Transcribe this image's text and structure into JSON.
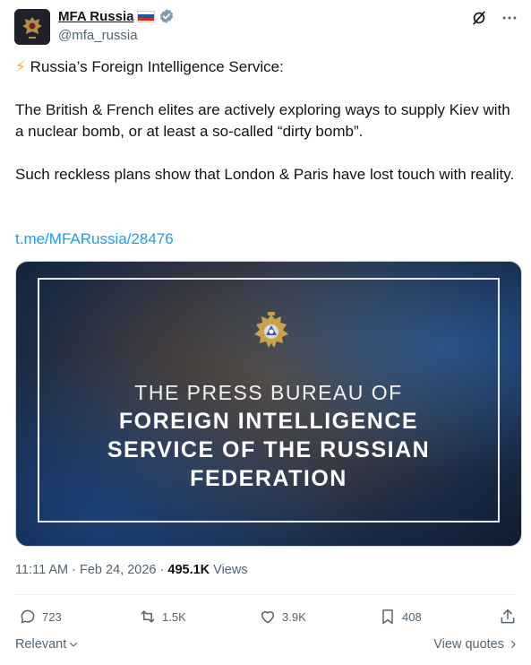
{
  "author": {
    "name": "MFA Russia",
    "handle": "@mfa_russia"
  },
  "post": {
    "emoji": "⚡",
    "line1": "Russia’s Foreign Intelligence Service:",
    "paragraph2": "The British & French elites are actively exploring ways to supply Kiev with a nuclear bomb, or at least a so-called “dirty bomb”.",
    "paragraph3": "Such reckless plans show that London & Paris have lost touch with reality.",
    "link": "t.me/MFARussia/28476"
  },
  "media": {
    "line1": "THE PRESS BUREAU OF",
    "line2a": "FOREIGN INTELLIGENCE",
    "line2b": "SERVICE OF THE RUSSIAN",
    "line2c": "FEDERATION"
  },
  "meta": {
    "time": "11:11 AM",
    "date": "Feb 24, 2026",
    "views_count": "495.1K",
    "views_label": "Views"
  },
  "actions": {
    "replies": "723",
    "reposts": "1.5K",
    "likes": "3.9K",
    "bookmarks": "408"
  },
  "footer": {
    "relevant": "Relevant",
    "view_quotes": "View quotes"
  },
  "colors": {
    "accent": "#1d9bf0",
    "muted": "#536471",
    "verified_badge": "#829aab"
  }
}
